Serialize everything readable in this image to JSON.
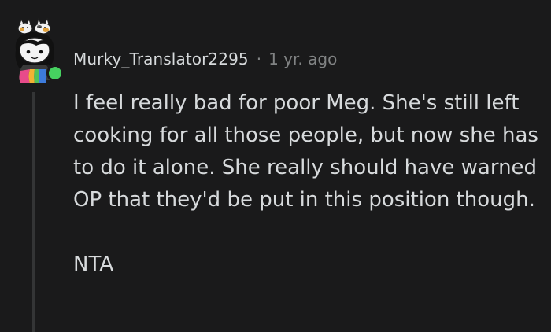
{
  "comment": {
    "author": "Murky_Translator2295",
    "separator": "·",
    "timestamp": "1 yr. ago",
    "paragraphs": [
      "I feel really bad for poor Meg. She's still left cooking for all those people, but now she has to do it alone. She really should have warned OP that they'd be put in this position though.",
      "NTA"
    ],
    "avatar_icon": "snoo-avatar-with-cats-icon",
    "online_status": "online"
  },
  "colors": {
    "background": "#1a1a1b",
    "text": "#d7dadc",
    "meta": "#818384",
    "online": "#46d160",
    "thread_line": "#343536"
  }
}
